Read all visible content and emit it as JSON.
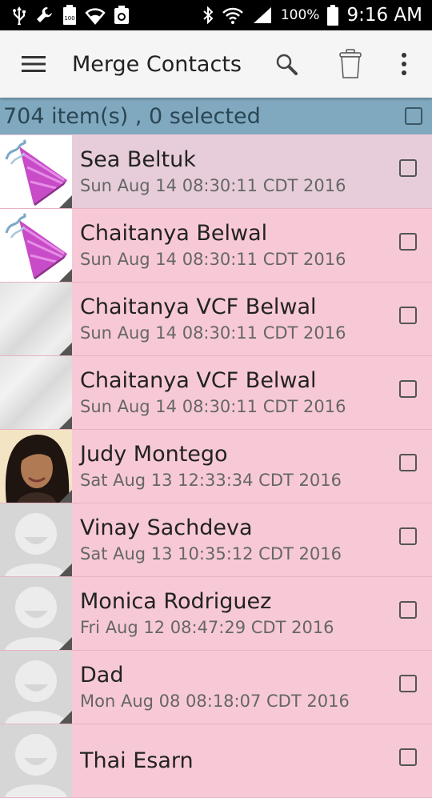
{
  "status_bar": {
    "battery_percent": "100%",
    "time": "9:16 AM"
  },
  "app_bar": {
    "title": "Merge Contacts"
  },
  "selection": {
    "summary": "704 item(s) , 0 selected"
  },
  "contacts": [
    {
      "name": "Sea Beltuk",
      "date": "Sun Aug 14 08:30:11 CDT 2016",
      "avatar": "party-hat-icon"
    },
    {
      "name": "Chaitanya Belwal",
      "date": "Sun Aug 14 08:30:11 CDT 2016",
      "avatar": "party-hat-icon"
    },
    {
      "name": "Chaitanya VCF Belwal",
      "date": "Sun Aug 14 08:30:11 CDT 2016",
      "avatar": "texture"
    },
    {
      "name": "Chaitanya VCF Belwal",
      "date": "Sun Aug 14 08:30:11 CDT 2016",
      "avatar": "texture"
    },
    {
      "name": "Judy Montego",
      "date": "Sat Aug 13 12:33:34 CDT 2016",
      "avatar": "photo"
    },
    {
      "name": "Vinay Sachdeva",
      "date": "Sat Aug 13 10:35:12 CDT 2016",
      "avatar": "default-person-icon"
    },
    {
      "name": "Monica Rodriguez",
      "date": "Fri Aug 12 08:47:29 CDT 2016",
      "avatar": "default-person-icon"
    },
    {
      "name": "Dad",
      "date": "Mon Aug 08 08:18:07 CDT 2016",
      "avatar": "default-person-icon"
    },
    {
      "name": "Thai Esarn",
      "date": "",
      "avatar": "default-person-icon"
    }
  ],
  "colors": {
    "row_background": "#f7c9d6",
    "first_row_background": "#e6cdd9",
    "selection_bar": "#80a9bf",
    "app_bar": "#f5f5f5",
    "status_bar": "#000000"
  }
}
